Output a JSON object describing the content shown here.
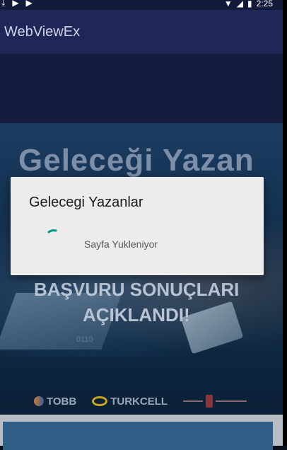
{
  "status_bar": {
    "time": "2:25",
    "icons": [
      "download-icon",
      "play-store-icon",
      "play-icon",
      "wifi-icon",
      "signal-icon",
      "battery-icon"
    ]
  },
  "app_bar": {
    "title": "WebViewEx"
  },
  "webpage": {
    "banner_headline": "Geleceği Yazan",
    "banner_line1": "BAŞVURU SONUÇLARI",
    "banner_line2": "AÇIKLANDI!",
    "banner_binary": "0110",
    "sponsors": [
      "TOBB",
      "TURKCELL"
    ]
  },
  "dialog": {
    "title": "Gelecegi Yazanlar",
    "message": "Sayfa Yukleniyor"
  },
  "colors": {
    "app_bar": "#1f2658",
    "dialog_bg": "#ececec",
    "spinner": "#009688"
  }
}
